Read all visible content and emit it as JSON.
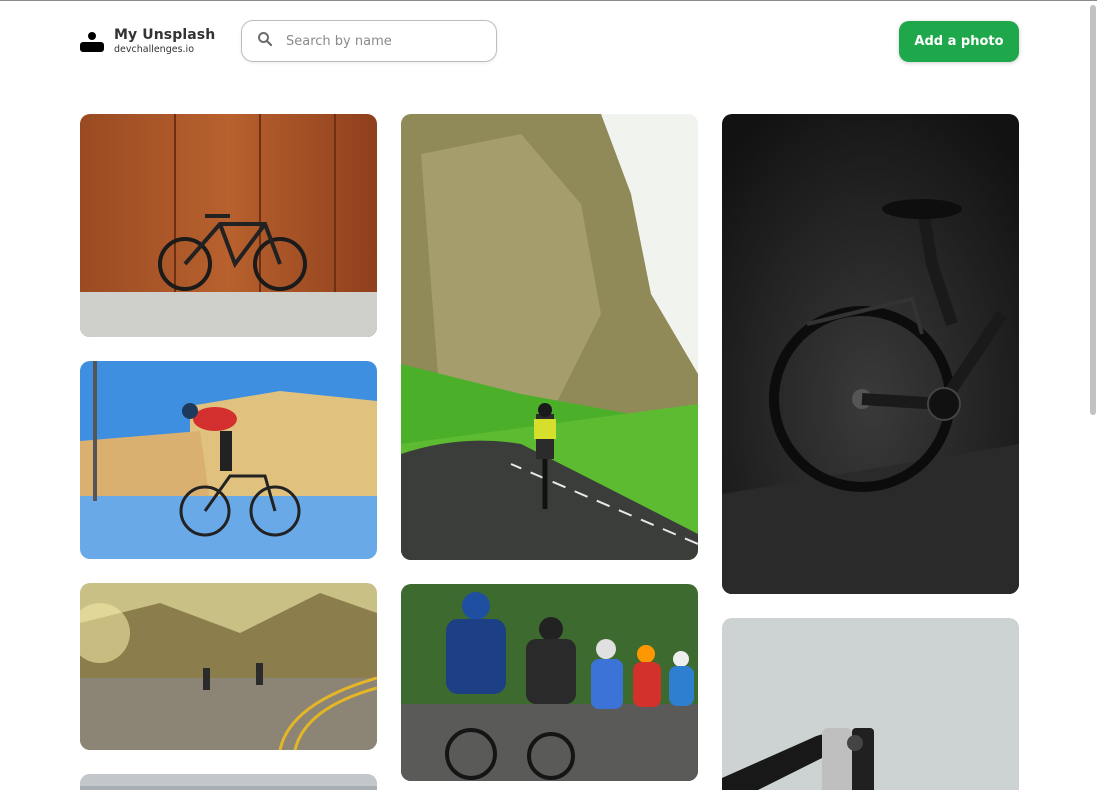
{
  "header": {
    "title": "My Unsplash",
    "subtitle": "devchallenges.io",
    "search_placeholder": "Search by name",
    "add_button_label": "Add a photo"
  },
  "photos": [
    {
      "subject": "bike-against-rusty-wall"
    },
    {
      "subject": "cyclist-city-street"
    },
    {
      "subject": "cyclists-mountain-road"
    },
    {
      "subject": "cyclist-cliff-road"
    },
    {
      "subject": "cycling-peloton"
    },
    {
      "subject": "bike-dark-background"
    },
    {
      "subject": "bike-handlebar-closeup"
    },
    {
      "subject": "photo-partial"
    }
  ],
  "colors": {
    "accent": "#1ea84b"
  }
}
